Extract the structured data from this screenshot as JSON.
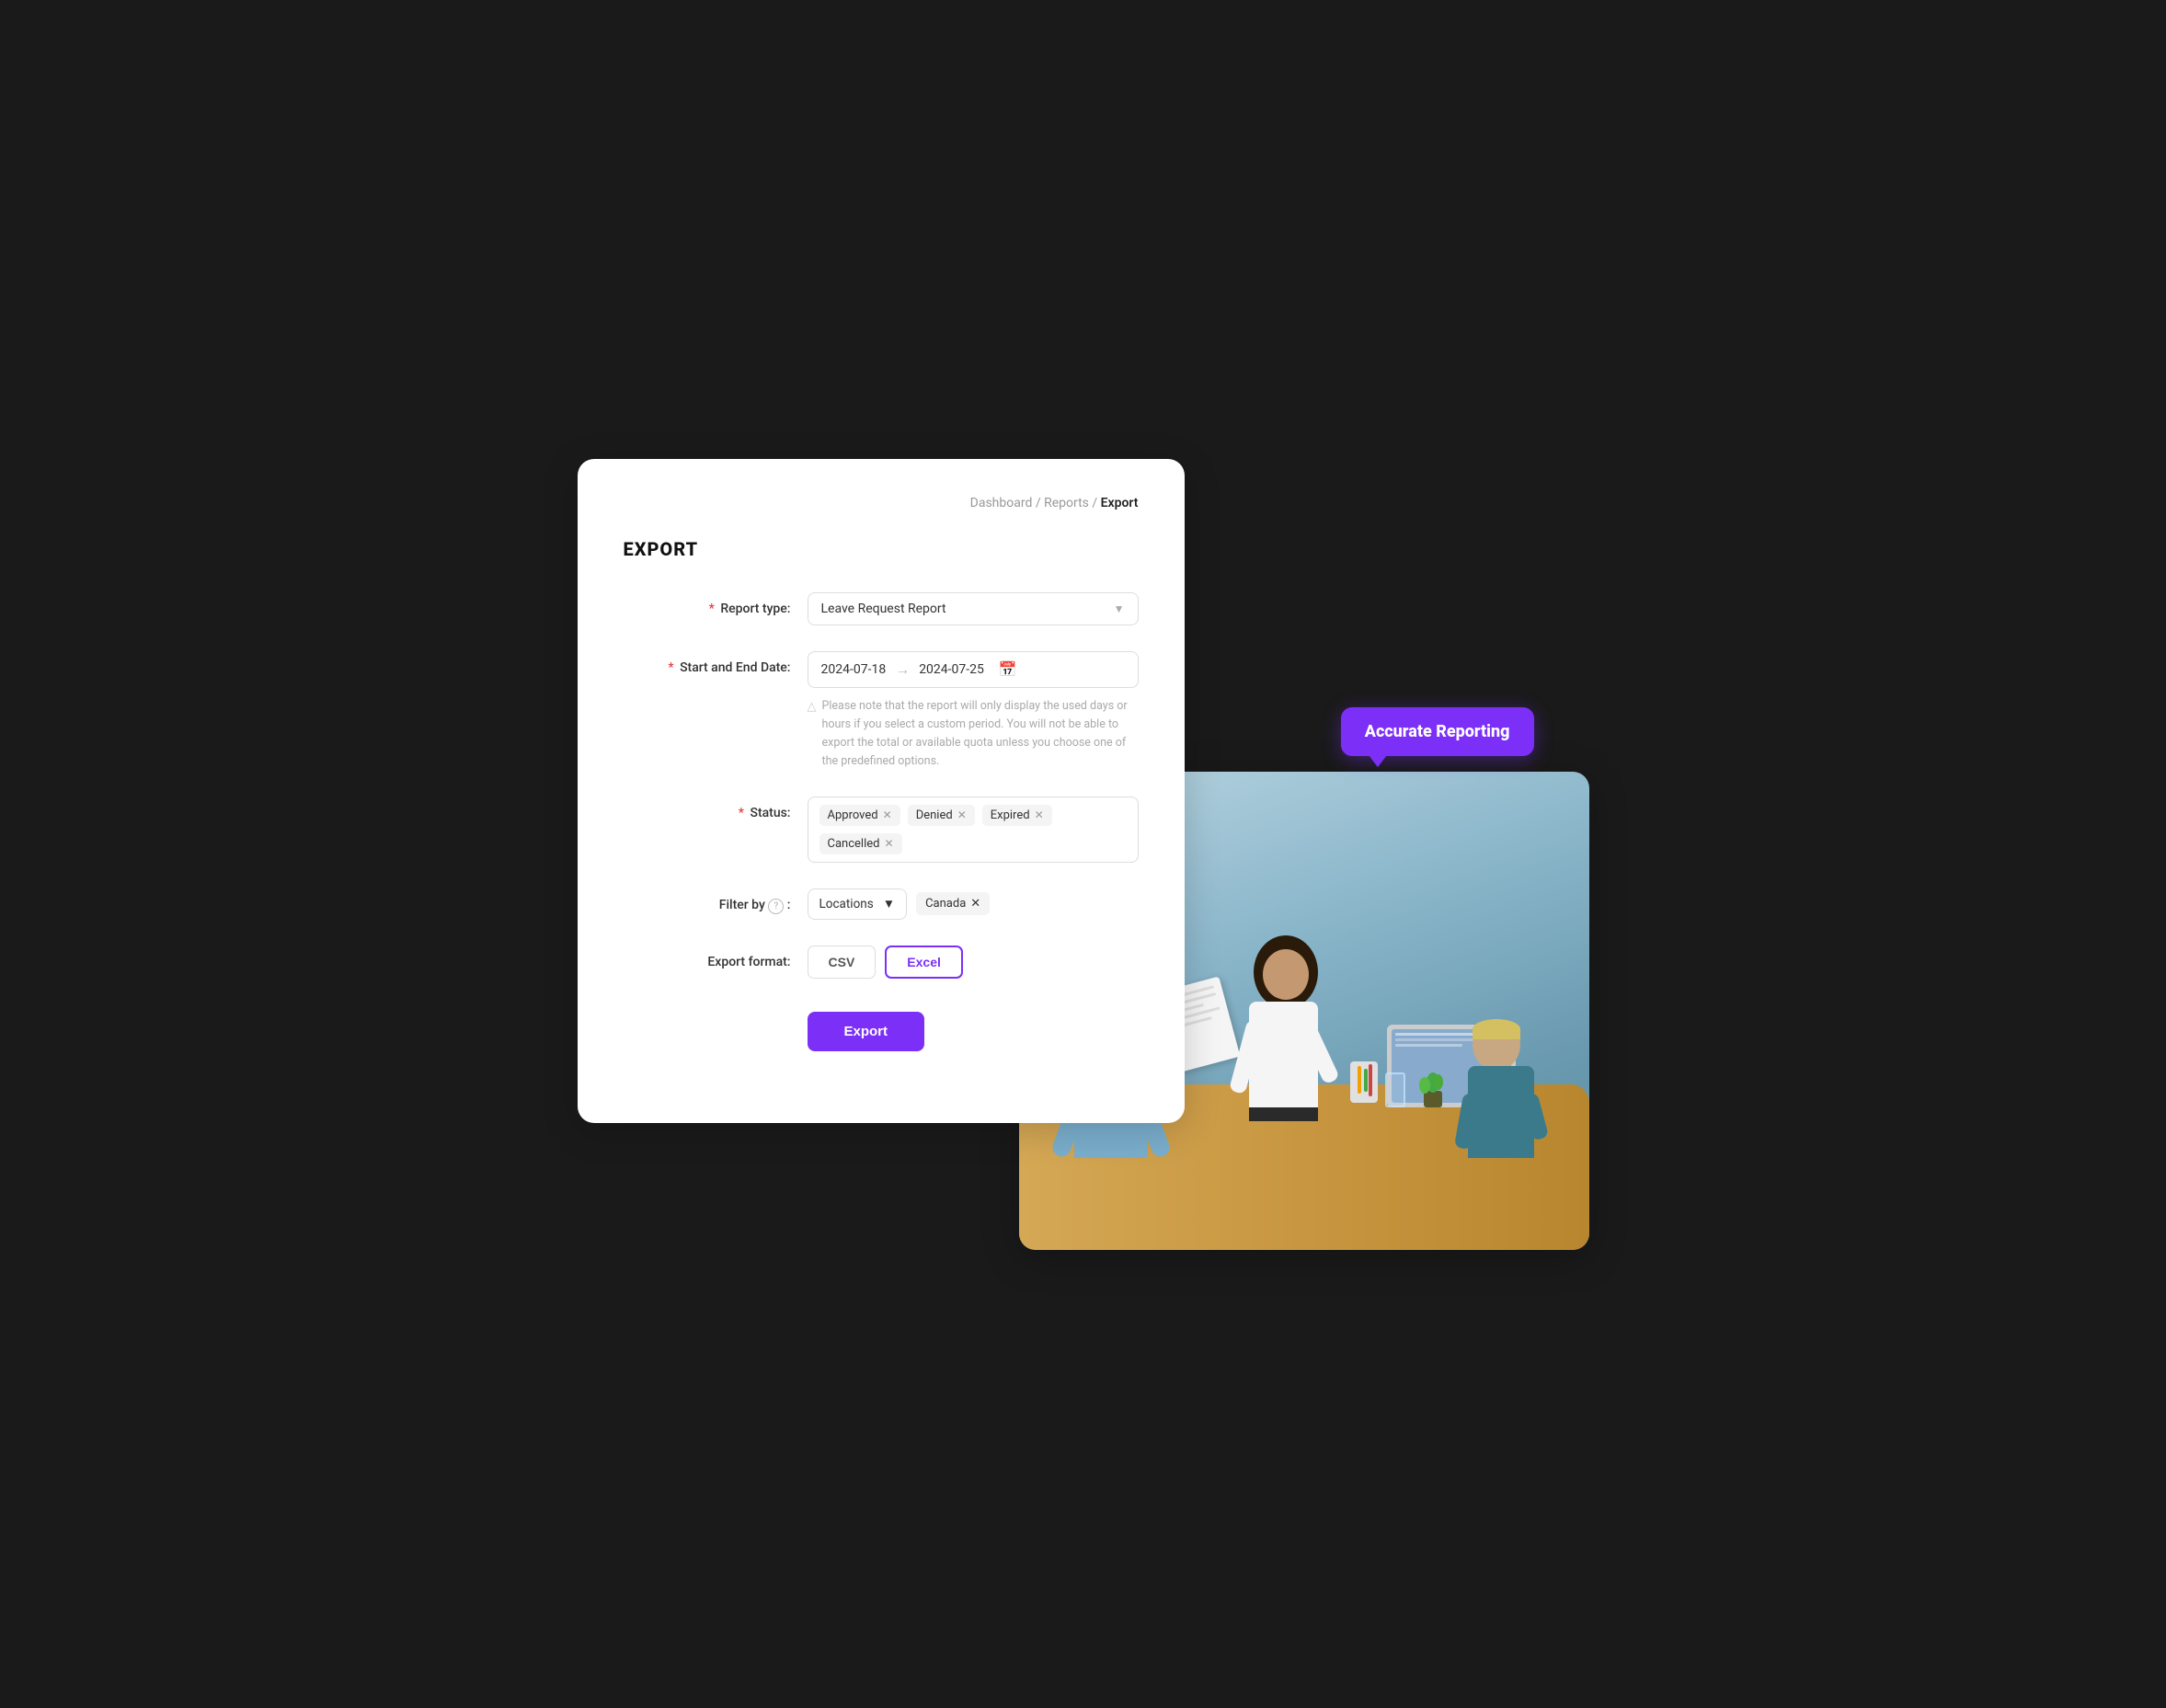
{
  "page": {
    "title": "EXPORT"
  },
  "breadcrumb": {
    "items": [
      "Dashboard",
      "Reports",
      "Export"
    ],
    "separator": "/"
  },
  "form": {
    "report_type": {
      "label": "Report type:",
      "value": "Leave Request Report",
      "required": true
    },
    "date_range": {
      "label": "Start and End Date:",
      "start": "2024-07-18",
      "end": "2024-07-25",
      "hint": "Please note that the report will only display the used days or hours if you select a custom period. You will not be able to export the total or available quota unless you choose one of the predefined options.",
      "required": true
    },
    "status": {
      "label": "Status:",
      "required": true,
      "tags": [
        {
          "label": "Approved"
        },
        {
          "label": "Denied"
        },
        {
          "label": "Expired"
        },
        {
          "label": "Cancelled"
        }
      ]
    },
    "filter_by": {
      "label": "Filter by",
      "dropdown_value": "Locations",
      "filter_tag": "Canada"
    },
    "export_format": {
      "label": "Export format:",
      "options": [
        {
          "label": "CSV",
          "active": false
        },
        {
          "label": "Excel",
          "active": true
        }
      ]
    },
    "export_button": "Export"
  },
  "reporting_bubble": {
    "text": "Accurate Reporting"
  }
}
